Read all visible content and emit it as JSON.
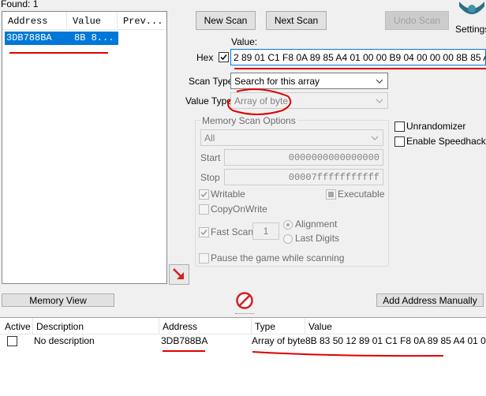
{
  "found_label": "Found: 1",
  "results_list": {
    "columns": [
      "Address",
      "Value",
      "Prev..."
    ],
    "rows": [
      {
        "address": "3DB788BA",
        "value": "8B 8..."
      }
    ]
  },
  "buttons": {
    "new_scan": "New Scan",
    "next_scan": "Next Scan",
    "undo_scan": "Undo Scan",
    "settings": "Settings",
    "memory_view": "Memory View",
    "add_address_manually": "Add Address Manually"
  },
  "value_section": {
    "value_label": "Value:",
    "hex_label": "Hex",
    "hex_checked": true,
    "value_text": "2 89 01 C1 F8 0A 89 85 A4 01 00 00 B9 04 00 00 00 8B 85 A4 01"
  },
  "scan_type": {
    "label": "Scan Type",
    "selected": "Search for this array"
  },
  "value_type": {
    "label": "Value Type",
    "selected": "Array of byte"
  },
  "memory_scan_options": {
    "title": "Memory Scan Options",
    "region": "All",
    "start_label": "Start",
    "start_value": "0000000000000000",
    "stop_label": "Stop",
    "stop_value": "00007fffffffffff",
    "writable": "Writable",
    "executable": "Executable",
    "copy_on_write": "CopyOnWrite",
    "fast_scan": "Fast Scan",
    "fast_scan_value": "1",
    "alignment": "Alignment",
    "last_digits": "Last Digits",
    "pause_game": "Pause the game while scanning"
  },
  "right_options": {
    "unrandomizer": "Unrandomizer",
    "enable_speedhack": "Enable Speedhack"
  },
  "address_table": {
    "columns": [
      "Active",
      "Description",
      "Address",
      "Type",
      "Value"
    ],
    "rows": [
      {
        "active": false,
        "description": "No description",
        "address": "3DB788BA",
        "type": "Array of byte",
        "value": "8B 83 50 12 89 01 C1 F8 0A 89 85 A4 01 00 00"
      }
    ]
  },
  "colors": {
    "selection": "#0078d7",
    "annotation": "#e00000",
    "accent_arrow": "#d02020"
  }
}
